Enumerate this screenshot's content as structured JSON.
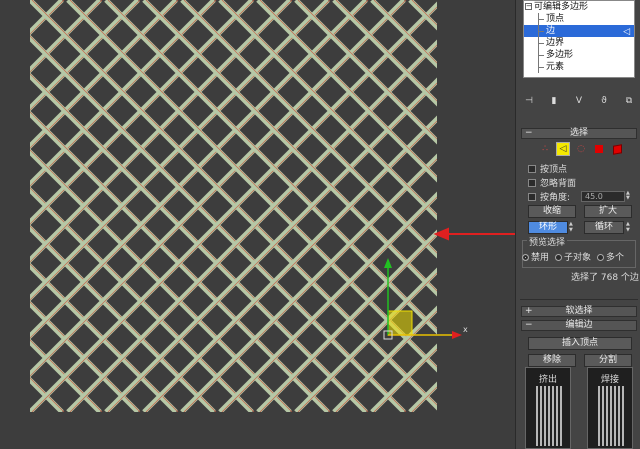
{
  "viewport": {
    "label": "",
    "axis_x_label": "x",
    "mesh_color": "#b6c8a6",
    "mesh_edge_color": "#c8543c",
    "background": "#3d3d3d"
  },
  "modifier_stack": {
    "items": [
      {
        "label": "可编辑多边形",
        "level": "top"
      },
      {
        "label": "顶点",
        "level": "sub"
      },
      {
        "label": "边",
        "level": "sub",
        "selected": true
      },
      {
        "label": "边界",
        "level": "sub"
      },
      {
        "label": "多边形",
        "level": "sub"
      },
      {
        "label": "元素",
        "level": "sub"
      }
    ]
  },
  "selection_rollout": {
    "title": "选择",
    "by_vertex_label": "按顶点",
    "ignore_backfacing_label": "忽略背面",
    "by_angle_label": "按角度:",
    "angle_value": "45.0",
    "shrink_label": "收缩",
    "grow_label": "扩大",
    "ring_label": "环形",
    "loop_label": "循环",
    "preview_title": "预览选择",
    "preview_options": [
      "禁用",
      "子对象",
      "多个"
    ],
    "status": "选择了 768 个边"
  },
  "soft_selection": {
    "title": "软选择"
  },
  "edit_edges": {
    "title": "编辑边",
    "insert_vertex_label": "插入顶点",
    "remove_label": "移除",
    "split_label": "分割",
    "extrude_label": "挤出",
    "weld_label": "焊接"
  },
  "colors": {
    "accent_selected": "#2b6ad8",
    "ring_button": "#4f8be0",
    "arrow": "#e02020",
    "gizmo_x": "#e02020",
    "gizmo_y": "#22c022",
    "gizmo_plane": "#f0e000"
  }
}
